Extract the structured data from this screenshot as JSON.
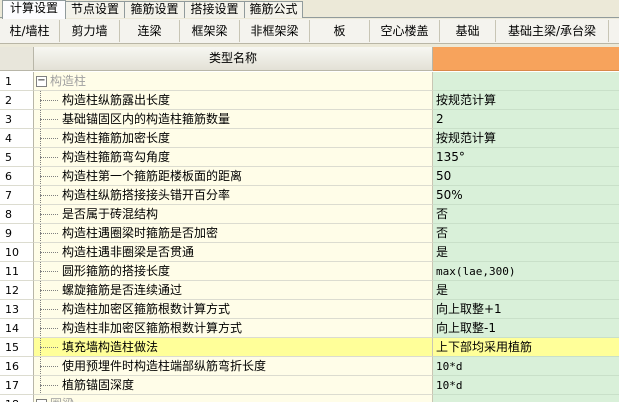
{
  "tabs": [
    {
      "label": "计算设置",
      "active": true
    },
    {
      "label": "节点设置",
      "active": false
    },
    {
      "label": "箍筋设置",
      "active": false
    },
    {
      "label": "搭接设置",
      "active": false
    },
    {
      "label": "箍筋公式",
      "active": false
    }
  ],
  "subtabs": [
    {
      "label": "柱/墙柱",
      "active": false
    },
    {
      "label": "剪力墙",
      "active": false
    },
    {
      "label": "连梁",
      "active": false
    },
    {
      "label": "框架梁",
      "active": false
    },
    {
      "label": "非框架梁",
      "active": false
    },
    {
      "label": "板",
      "active": false
    },
    {
      "label": "空心楼盖",
      "active": false
    },
    {
      "label": "基础",
      "active": false
    },
    {
      "label": "基础主梁/承台梁",
      "active": false
    }
  ],
  "grid": {
    "header_name": "类型名称",
    "rows": [
      {
        "num": "1",
        "name": "构造柱",
        "value": "",
        "group": true
      },
      {
        "num": "2",
        "name": "构造柱纵筋露出长度",
        "value": "按规范计算"
      },
      {
        "num": "3",
        "name": "基础锚固区内的构造柱箍筋数量",
        "value": "2"
      },
      {
        "num": "4",
        "name": "构造柱箍筋加密长度",
        "value": "按规范计算"
      },
      {
        "num": "5",
        "name": "构造柱箍筋弯勾角度",
        "value": "135°"
      },
      {
        "num": "6",
        "name": "构造柱第一个箍筋距楼板面的距离",
        "value": "50"
      },
      {
        "num": "7",
        "name": "构造柱纵筋搭接接头错开百分率",
        "value": "50%"
      },
      {
        "num": "8",
        "name": "是否属于砖混结构",
        "value": "否"
      },
      {
        "num": "9",
        "name": "构造柱遇圈梁时箍筋是否加密",
        "value": "否"
      },
      {
        "num": "10",
        "name": "构造柱遇非圈梁是否贯通",
        "value": "是"
      },
      {
        "num": "11",
        "name": "圆形箍筋的搭接长度",
        "value": "max(lae,300)",
        "mono": true
      },
      {
        "num": "12",
        "name": "螺旋箍筋是否连续通过",
        "value": "是"
      },
      {
        "num": "13",
        "name": "构造柱加密区箍筋根数计算方式",
        "value": "向上取整+1"
      },
      {
        "num": "14",
        "name": "构造柱非加密区箍筋根数计算方式",
        "value": "向上取整-1"
      },
      {
        "num": "15",
        "name": "填充墙构造柱做法",
        "value": "上下部均采用植筋",
        "highlight": true
      },
      {
        "num": "16",
        "name": "使用预埋件时构造柱端部纵筋弯折长度",
        "value": "10*d",
        "mono": true
      },
      {
        "num": "17",
        "name": "植筋锚固深度",
        "value": "10*d",
        "mono": true
      },
      {
        "num": "18",
        "name": "圈梁",
        "value": "",
        "group": true
      }
    ]
  },
  "icons": {
    "expander": "minus-expander-icon"
  }
}
